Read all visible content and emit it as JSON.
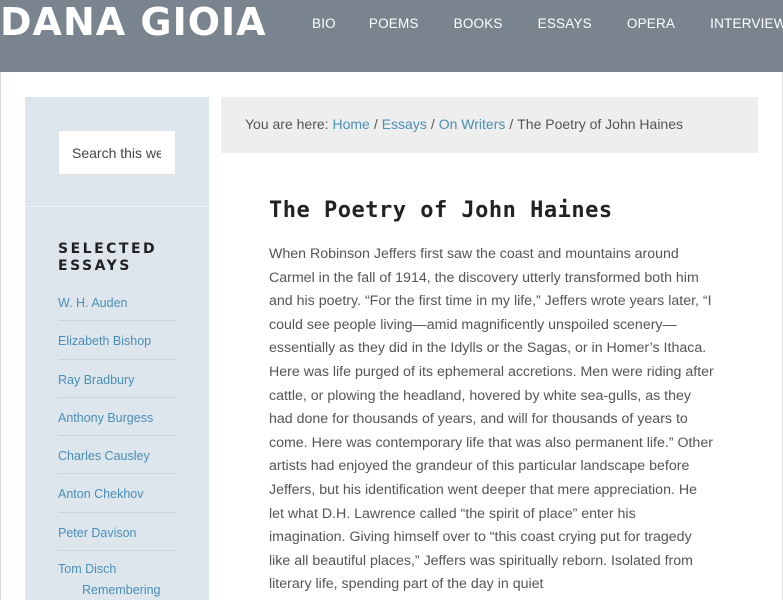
{
  "site": {
    "logo": "DANA GIOIA",
    "nav": [
      "BIO",
      "POEMS",
      "BOOKS",
      "ESSAYS",
      "OPERA",
      "INTERVIEWS"
    ]
  },
  "sidebar": {
    "search_placeholder": "Search this website",
    "widget_title": "SELECTED ESSAYS",
    "essays": [
      "W. H. Auden",
      "Elizabeth Bishop",
      "Ray Bradbury",
      "Anthony Burgess",
      "Charles Causley",
      "Anton Chekhov",
      "Peter Davison",
      "Tom Disch"
    ],
    "essay_last_continued": "Remembering"
  },
  "breadcrumb": {
    "prefix": "You are here:",
    "home": "Home",
    "essays": "Essays",
    "on_writers": "On Writers",
    "current": "The Poetry of John Haines"
  },
  "article": {
    "title": "The Poetry of John Haines",
    "body": "When Robinson Jeffers first saw the coast and mountains around Carmel in the fall of 1914, the discovery utterly transformed both him and his poetry. “For the first time in my life,” Jeffers wrote years later, “I could see people living—amid magnificently unspoiled scenery—essentially as they did in the Idylls or the Sagas, or in Homer’s Ithaca. Here was life purged of its ephemeral accretions. Men were riding after cattle, or plowing the headland, hovered by white sea-gulls, as they had done for thousands of years, and will for thousands of years to come. Here was contemporary life that was also permanent life.” Other artists had enjoyed the grandeur of this particular landscape before Jeffers, but his identification went deeper that mere appreciation. He let what D.H. Lawrence called “the spirit of place” enter his imagination. Giving himself over to “this coast crying put for tragedy like all beautiful places,” Jeffers was spiritually reborn. Isolated from literary life, spending part of the day in quiet"
  }
}
